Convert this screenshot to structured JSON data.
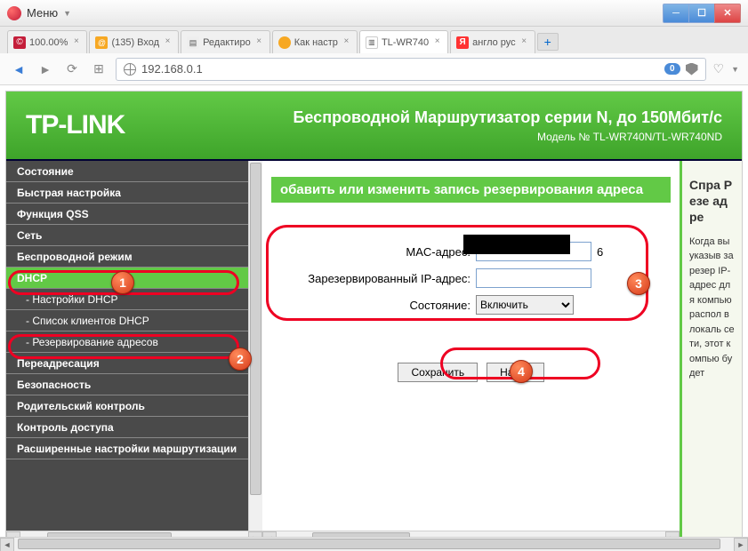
{
  "window": {
    "menu_label": "Меню"
  },
  "tabs": [
    {
      "label": "100.00%",
      "icon": "#c41e3a",
      "prefix": "©",
      "active": false
    },
    {
      "label": "(135) Вход",
      "icon": "#f7a823",
      "prefix": "@",
      "active": false
    },
    {
      "label": "Редактиро",
      "icon": "#c8c8c8",
      "prefix": "📄",
      "active": false
    },
    {
      "label": "Как настр",
      "icon": "#f7a823",
      "prefix": "●",
      "active": false
    },
    {
      "label": "TL-WR740",
      "icon": "#fff",
      "prefix": "▥",
      "active": true
    },
    {
      "label": "англо рус",
      "icon": "#ff3333",
      "prefix": "Я",
      "active": false
    }
  ],
  "address": {
    "url": "192.168.0.1",
    "badge": "0"
  },
  "banner": {
    "logo": "TP-LINK",
    "title": "Беспроводной Маршрутизатор серии N, до 150Мбит/с",
    "subtitle": "Модель № TL-WR740N/TL-WR740ND"
  },
  "nav": [
    {
      "label": "Состояние",
      "sub": false,
      "active": false
    },
    {
      "label": "Быстрая настройка",
      "sub": false,
      "active": false
    },
    {
      "label": "Функция QSS",
      "sub": false,
      "active": false
    },
    {
      "label": "Сеть",
      "sub": false,
      "active": false
    },
    {
      "label": "Беспроводной режим",
      "sub": false,
      "active": false
    },
    {
      "label": "DHCP",
      "sub": false,
      "active": true
    },
    {
      "label": "- Настройки DHCP",
      "sub": true,
      "active": false
    },
    {
      "label": "- Список клиентов DHCP",
      "sub": true,
      "active": false
    },
    {
      "label": "- Резервирование адресов",
      "sub": true,
      "active": false
    },
    {
      "label": "Переадресация",
      "sub": false,
      "active": false
    },
    {
      "label": "Безопасность",
      "sub": false,
      "active": false
    },
    {
      "label": "Родительский контроль",
      "sub": false,
      "active": false
    },
    {
      "label": "Контроль доступа",
      "sub": false,
      "active": false
    },
    {
      "label": "Расширенные настройки маршрутизации",
      "sub": false,
      "active": false
    }
  ],
  "main": {
    "heading": "обавить или изменить запись резервирования адреса",
    "labels": {
      "mac": "MAC-адрес:",
      "ip": "Зарезервированный IP-адрес:",
      "state": "Состояние:"
    },
    "values": {
      "mac_suffix": "6",
      "ip": "",
      "state": "Включить"
    },
    "buttons": {
      "save": "Сохранить",
      "back": "Назад"
    }
  },
  "help": {
    "title": "Спра\nРезе\nадре",
    "body": "Когда вы указыв зарезер IP-адрес для компью распол в локаль сети, этот компью будет"
  },
  "markers": {
    "1": "1",
    "2": "2",
    "3": "3",
    "4": "4"
  }
}
